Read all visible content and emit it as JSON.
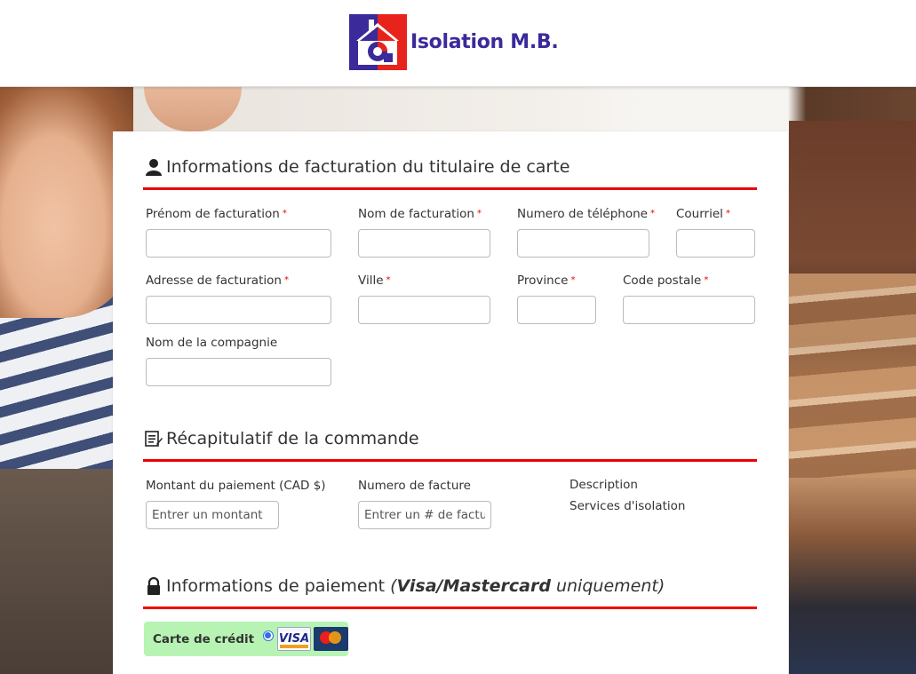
{
  "brand": {
    "name": "Isolation M.B.",
    "colors": {
      "accent_red": "#e00000",
      "brand_blue": "#3a2a9a",
      "card_bg": "#b7f4b4"
    }
  },
  "billing": {
    "title": "Informations de facturation du titulaire de carte",
    "icon": "user-icon",
    "required_marker": "*",
    "fields": {
      "first_name": "Prénom de facturation",
      "last_name": "Nom de facturation",
      "phone": "Numero de téléphone",
      "email": "Courriel",
      "address": "Adresse de facturation",
      "city": "Ville",
      "province": "Province",
      "postal_code": "Code postale",
      "company": "Nom de la compagnie"
    }
  },
  "summary": {
    "title": "Récapitulatif de la commande",
    "icon": "list-edit-icon",
    "amount_label": "Montant du paiement (CAD $)",
    "amount_placeholder": "Entrer un montant",
    "invoice_label": "Numero de facture",
    "invoice_placeholder": "Entrer un # de facture",
    "description_label": "Description",
    "description_value": "Services d'isolation"
  },
  "payment": {
    "title_prefix": "Informations de paiement ",
    "title_em_open": "(",
    "title_strong": "Visa/Mastercard",
    "title_em_close": " uniquement)",
    "icon": "lock-icon",
    "card_label": "Carte de crédit",
    "visa_text": "VISA",
    "selected": true
  }
}
